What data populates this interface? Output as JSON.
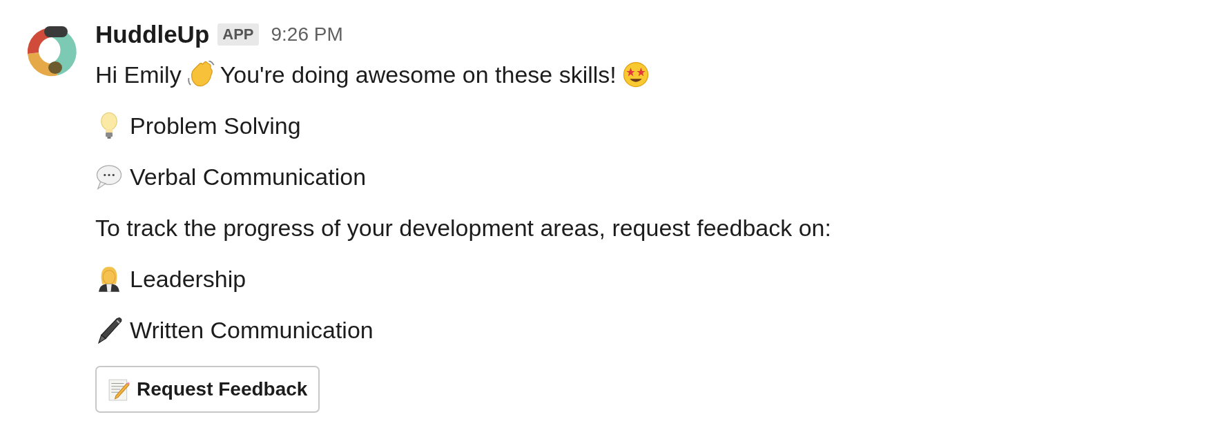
{
  "message": {
    "sender": "HuddleUp",
    "badge": "APP",
    "time": "9:26 PM",
    "greeting": [
      "Hi Emily",
      "You're doing awesome on these skills!"
    ],
    "skills": [
      {
        "label": "Problem Solving"
      },
      {
        "label": "Verbal Communication"
      }
    ],
    "prompt": "To track the progress of your development areas, request feedback on:",
    "development_areas": [
      {
        "label": "Leadership"
      },
      {
        "label": "Written Communication"
      }
    ],
    "button": {
      "label": "Request Feedback"
    }
  }
}
